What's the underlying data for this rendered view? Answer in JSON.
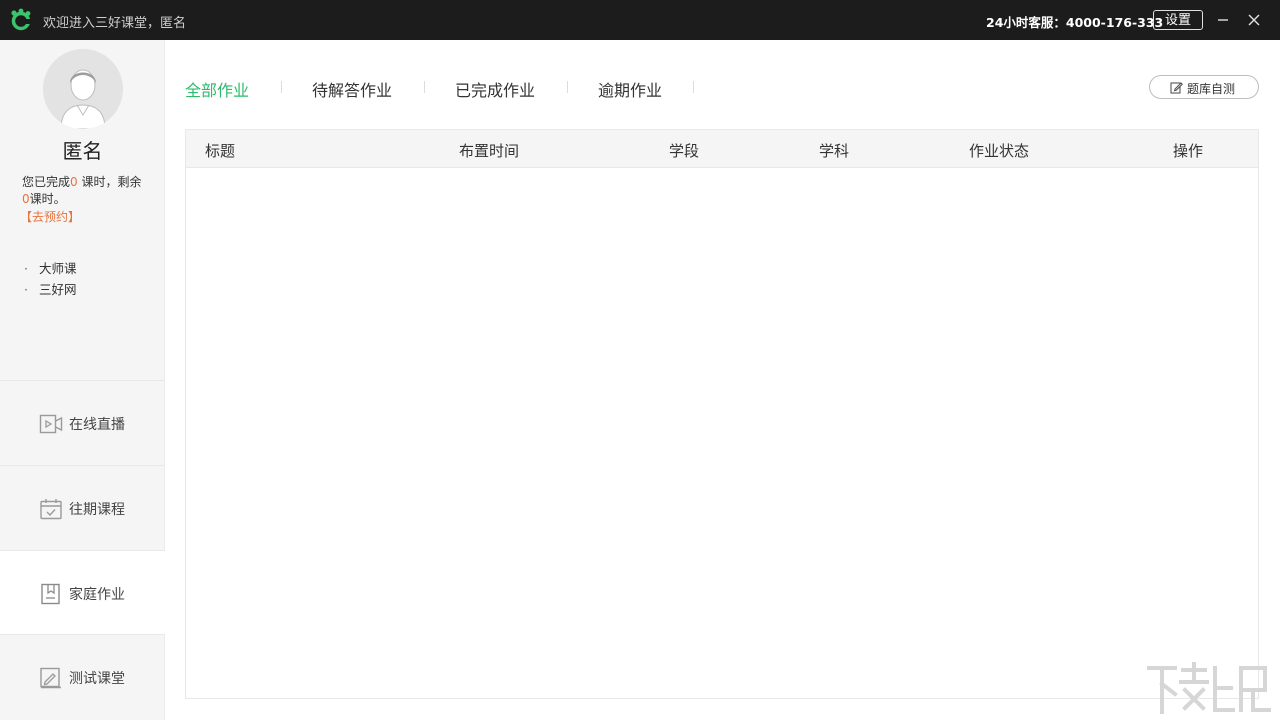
{
  "titlebar": {
    "welcome": "欢迎进入三好课堂，匿名",
    "hotline": "24小时客服：4000-176-333",
    "settings_label": "设置"
  },
  "sidebar": {
    "user_name": "匿名",
    "progress": {
      "prefix": "您已完成",
      "completed": "0",
      "middle": " 课时，剩余",
      "remaining": "0",
      "suffix": "课时。"
    },
    "reserve_link": "【去预约】",
    "links": [
      {
        "label": "大师课"
      },
      {
        "label": "三好网"
      }
    ],
    "nav": [
      {
        "label": "在线直播",
        "icon": "video-icon"
      },
      {
        "label": "往期课程",
        "icon": "calendar-check-icon"
      },
      {
        "label": "家庭作业",
        "icon": "homework-icon",
        "active": true
      },
      {
        "label": "测试课堂",
        "icon": "test-icon"
      }
    ]
  },
  "main": {
    "tabs": [
      {
        "label": "全部作业",
        "active": true
      },
      {
        "label": "待解答作业"
      },
      {
        "label": "已完成作业"
      },
      {
        "label": "逾期作业"
      }
    ],
    "selftest_label": "题库自测",
    "table": {
      "headers": [
        "标题",
        "布置时间",
        "学段",
        "学科",
        "作业状态",
        "操作"
      ],
      "rows": []
    }
  },
  "colors": {
    "accent": "#2dbb6b",
    "highlight": "#e8733b",
    "titlebar_bg": "#1c1c1c"
  }
}
